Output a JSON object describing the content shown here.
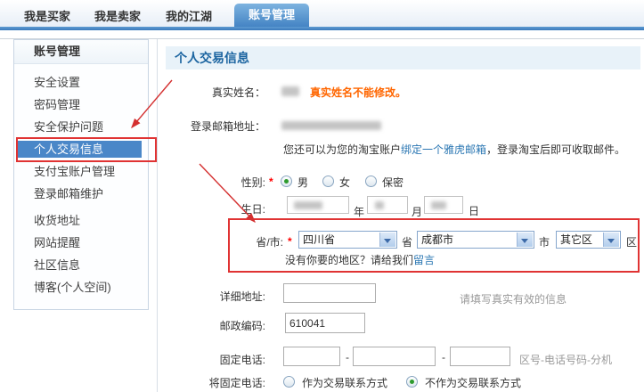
{
  "tabs": {
    "items": [
      {
        "label": "我是买家",
        "active": false
      },
      {
        "label": "我是卖家",
        "active": false
      },
      {
        "label": "我的江湖",
        "active": false
      },
      {
        "label": "账号管理",
        "active": true
      }
    ]
  },
  "sidebar": {
    "header": "账号管理",
    "items": [
      {
        "label": "安全设置",
        "active": false
      },
      {
        "label": "密码管理",
        "active": false
      },
      {
        "label": "安全保护问题",
        "active": false
      },
      {
        "label": "个人交易信息",
        "active": true
      },
      {
        "label": "支付宝账户管理",
        "active": false
      },
      {
        "label": "登录邮箱维护",
        "active": false
      },
      {
        "label": "收货地址",
        "active": false
      },
      {
        "label": "网站提醒",
        "active": false
      },
      {
        "label": "社区信息",
        "active": false
      },
      {
        "label": "博客(个人空间)",
        "active": false
      }
    ]
  },
  "main": {
    "header": "个人交易信息",
    "rows": {
      "real_name": {
        "label": "真实姓名：",
        "value": "",
        "note": "真实姓名不能修改。"
      },
      "email": {
        "label": "登录邮箱地址：",
        "value": "",
        "helper_pre": "您还可以为您的淘宝账户",
        "helper_link": "绑定一个雅虎邮箱",
        "helper_post": "，登录淘宝后即可收取邮件。"
      },
      "gender": {
        "label": "性别:",
        "required": "*",
        "options": [
          {
            "label": "男",
            "selected": true
          },
          {
            "label": "女",
            "selected": false
          },
          {
            "label": "保密",
            "selected": false
          }
        ]
      },
      "birthday": {
        "label": "生日:",
        "year_unit": "年",
        "month_unit": "月",
        "day_unit": "日"
      },
      "region": {
        "label": "省/市:",
        "required": "*",
        "province": {
          "value": "四川省",
          "suffix": "省"
        },
        "city": {
          "value": "成都市",
          "suffix": "市"
        },
        "district": {
          "value": "其它区",
          "suffix": "区"
        },
        "note_pre": "没有你要的地区？请给我们",
        "note_link": "留言"
      },
      "address": {
        "label": "详细地址:",
        "value": "",
        "hint": "请填写真实有效的信息"
      },
      "postcode": {
        "label": "邮政编码:",
        "value": "610041"
      },
      "phone": {
        "label": "固定电话:",
        "separator": "-",
        "hint": "区号-电话号码-分机"
      },
      "phone_use": {
        "label": "将固定电话:",
        "options": [
          {
            "label": "作为交易联系方式",
            "selected": false
          },
          {
            "label": "不作为交易联系方式",
            "selected": true
          }
        ]
      }
    }
  },
  "colors": {
    "tab_active_bg": "#4484c4",
    "tab_bar": "#3a79bb",
    "sidebar_selected_bg": "#4a87c8",
    "main_header_bg": "#e8f2f9",
    "main_header_text": "#1b64a0",
    "link_blue": "#2b77b3",
    "note_orange": "#ff6600",
    "annotation_red": "#e03333",
    "required_red": "#ff0000"
  }
}
